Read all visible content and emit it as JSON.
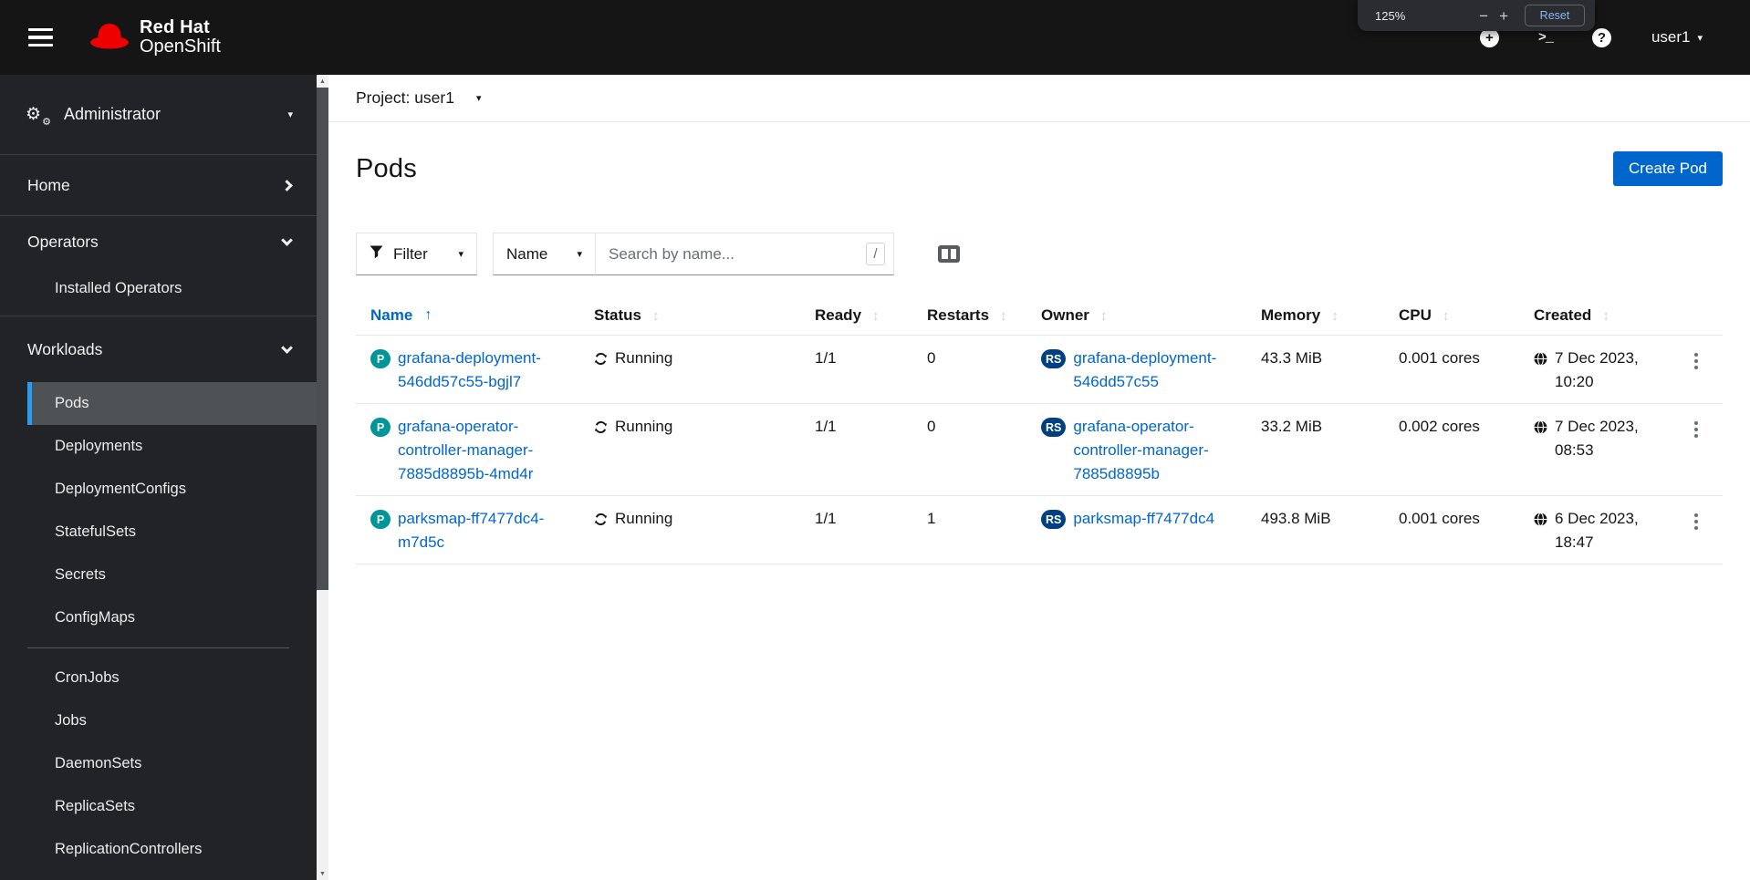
{
  "masthead": {
    "logo": {
      "brand": "Red Hat",
      "product": "OpenShift"
    },
    "icons": [
      {
        "name": "plus-circle-icon",
        "glyph": "+"
      },
      {
        "name": "terminal-icon",
        "glyph": ">_"
      },
      {
        "name": "help-icon",
        "glyph": "?"
      }
    ],
    "user": {
      "label": "user1"
    }
  },
  "zoom_popup": {
    "level": "125%",
    "minus": "−",
    "plus": "+",
    "reset_label": "Reset"
  },
  "sidebar": {
    "perspective": {
      "label": "Administrator"
    },
    "sections": [
      {
        "label": "Home",
        "expanded": false
      },
      {
        "label": "Operators",
        "expanded": true,
        "items": [
          {
            "label": "Installed Operators"
          }
        ]
      },
      {
        "label": "Workloads",
        "expanded": true,
        "items": [
          {
            "label": "Pods",
            "active": true
          },
          {
            "label": "Deployments"
          },
          {
            "label": "DeploymentConfigs"
          },
          {
            "label": "StatefulSets"
          },
          {
            "label": "Secrets"
          },
          {
            "label": "ConfigMaps"
          },
          {
            "divider": true
          },
          {
            "label": "CronJobs"
          },
          {
            "label": "Jobs"
          },
          {
            "label": "DaemonSets"
          },
          {
            "label": "ReplicaSets"
          },
          {
            "label": "ReplicationControllers"
          }
        ]
      }
    ]
  },
  "project_bar": {
    "label": "Project: user1"
  },
  "page": {
    "title": "Pods",
    "create_button": "Create Pod"
  },
  "toolbar": {
    "filter_label": "Filter",
    "attribute_label": "Name",
    "search_placeholder": "Search by name...",
    "search_shortcut": "/"
  },
  "table": {
    "columns": [
      {
        "label": "Name",
        "sorted": "asc"
      },
      {
        "label": "Status",
        "sortable": true
      },
      {
        "label": "Ready",
        "sortable": true
      },
      {
        "label": "Restarts",
        "sortable": true
      },
      {
        "label": "Owner",
        "sortable": true
      },
      {
        "label": "Memory",
        "sortable": true
      },
      {
        "label": "CPU",
        "sortable": true
      },
      {
        "label": "Created",
        "sortable": true
      }
    ],
    "rows": [
      {
        "badge": "P",
        "name_lines": [
          "grafana-deployment-",
          "546dd57c55-bgjl7"
        ],
        "status": "Running",
        "ready": "1/1",
        "restarts": "0",
        "owner_badge": "RS",
        "owner_lines": [
          "grafana-deployment-",
          "546dd57c55"
        ],
        "memory": "43.3 MiB",
        "cpu": "0.001 cores",
        "created_lines": [
          "7 Dec 2023,",
          "10:20"
        ]
      },
      {
        "badge": "P",
        "name_lines": [
          "grafana-operator-",
          "controller-manager-",
          "7885d8895b-4md4r"
        ],
        "status": "Running",
        "ready": "1/1",
        "restarts": "0",
        "owner_badge": "RS",
        "owner_lines": [
          "grafana-operator-",
          "controller-manager-",
          "7885d8895b"
        ],
        "memory": "33.2 MiB",
        "cpu": "0.002 cores",
        "created_lines": [
          "7 Dec 2023,",
          "08:53"
        ]
      },
      {
        "badge": "P",
        "name_lines": [
          "parksmap-ff7477dc4-",
          "m7d5c"
        ],
        "status": "Running",
        "ready": "1/1",
        "restarts": "1",
        "owner_badge": "RS",
        "owner_lines": [
          "parksmap-ff7477dc4"
        ],
        "memory": "493.8 MiB",
        "cpu": "0.001 cores",
        "created_lines": [
          "6 Dec 2023,",
          "18:47"
        ]
      }
    ]
  },
  "colors": {
    "accent": "#0066cc",
    "pod_badge": "#009596",
    "owner_badge": "#004080",
    "nav_active_indicator": "#2b9af3",
    "masthead_bg": "#151515",
    "sidebar_bg": "#212327"
  }
}
